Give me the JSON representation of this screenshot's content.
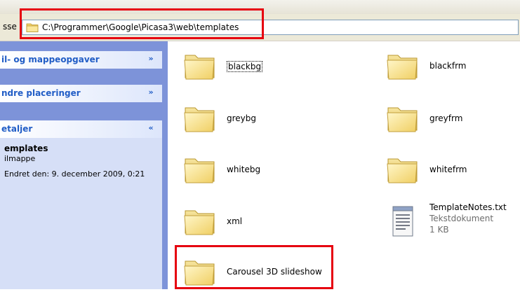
{
  "address_bar": {
    "label": "sse",
    "path": "C:\\Programmer\\Google\\Picasa3\\web\\templates"
  },
  "task_pane": {
    "file_tasks": {
      "title": "il- og mappeopgaver",
      "chevron": "»"
    },
    "other_places": {
      "title": "ndre placeringer",
      "chevron": "»"
    },
    "details": {
      "title": "etaljer",
      "chevron": "«",
      "name": "emplates",
      "type": "ilmappe",
      "modified": "Endret den: 9. december 2009, 0:21"
    }
  },
  "files": [
    {
      "name": "blackbg",
      "kind": "folder-icon"
    },
    {
      "name": "blackfrm",
      "kind": "folder-icon"
    },
    {
      "name": "greybg",
      "kind": "folder-icon"
    },
    {
      "name": "greyfrm",
      "kind": "folder-icon"
    },
    {
      "name": "whitebg",
      "kind": "folder-icon"
    },
    {
      "name": "whitefrm",
      "kind": "folder-icon"
    },
    {
      "name": "xml",
      "kind": "folder-icon"
    },
    {
      "name": "TemplateNotes.txt",
      "type": "Tekstdokument",
      "size": "1 KB",
      "kind": "text-document-icon"
    },
    {
      "name": "Carousel 3D slideshow",
      "kind": "folder-icon"
    }
  ],
  "colors": {
    "highlight": "#e6000f",
    "task_pane_bg": "#7d93d9",
    "task_title": "#215dc6"
  }
}
